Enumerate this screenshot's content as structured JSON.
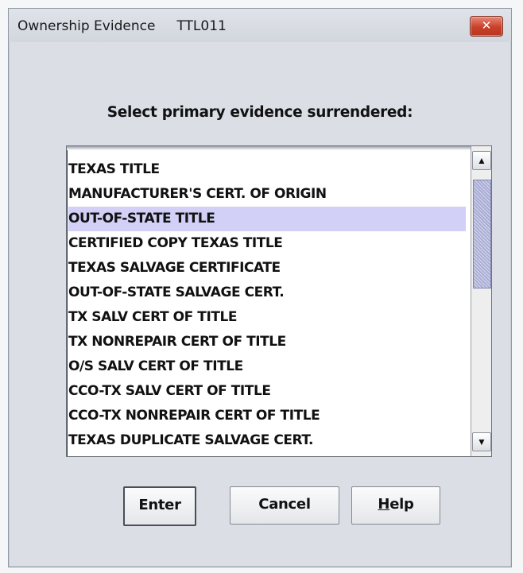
{
  "window": {
    "title": "Ownership Evidence",
    "code": "TTL011",
    "close_label": "✕"
  },
  "prompt": "Select primary evidence surrendered:",
  "evidence_list": {
    "selected_index": 2,
    "items": [
      "TEXAS TITLE",
      "MANUFACTURER'S CERT. OF ORIGIN",
      "OUT-OF-STATE TITLE",
      "CERTIFIED COPY TEXAS TITLE",
      "TEXAS SALVAGE CERTIFICATE",
      "OUT-OF-STATE SALVAGE CERT.",
      "TX SALV CERT OF TITLE",
      "TX NONREPAIR CERT OF TITLE",
      "O/S SALV CERT OF TITLE",
      "CCO-TX SALV CERT OF TITLE",
      "CCO-TX NONREPAIR CERT OF TITLE",
      "TEXAS DUPLICATE SALVAGE CERT."
    ]
  },
  "scrollbar": {
    "up_icon": "arrow-up-icon",
    "down_icon": "arrow-down-icon",
    "up_glyph": "▲",
    "down_glyph": "▼"
  },
  "buttons": {
    "enter": "Enter",
    "cancel": "Cancel",
    "help_mnemonic": "H",
    "help_rest": "elp"
  },
  "colors": {
    "selection": "#d2d0f6",
    "close_button": "#c8412a",
    "scroll_thumb": "#a9acd4"
  }
}
